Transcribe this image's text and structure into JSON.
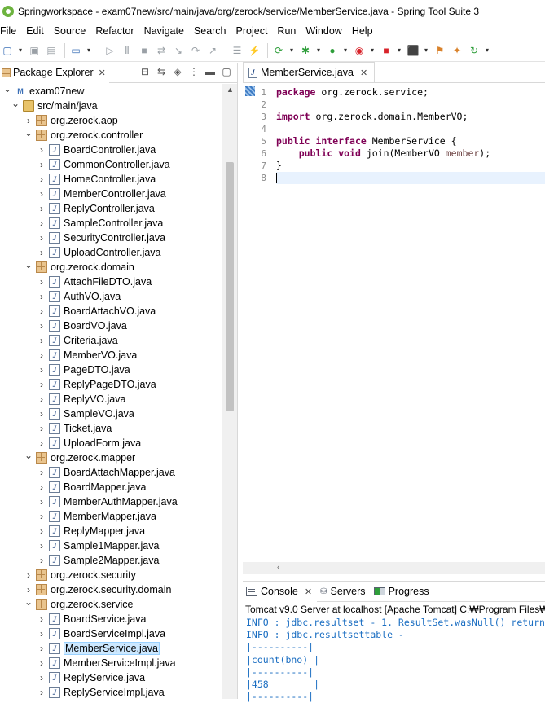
{
  "window": {
    "title": "Springworkspace - exam07new/src/main/java/org/zerock/service/MemberService.java - Spring Tool Suite 3"
  },
  "menu": [
    "File",
    "Edit",
    "Source",
    "Refactor",
    "Navigate",
    "Search",
    "Project",
    "Run",
    "Window",
    "Help"
  ],
  "package_explorer": {
    "tab_label": "Package Explorer",
    "close_glyph": "✕",
    "tree": [
      {
        "depth": 0,
        "twist": "expanded",
        "icon": "project-icon",
        "label": "exam07new"
      },
      {
        "depth": 1,
        "twist": "expanded",
        "icon": "source-folder-icon",
        "label": "src/main/java"
      },
      {
        "depth": 2,
        "twist": "collapsed",
        "icon": "package-icon",
        "label": "org.zerock.aop"
      },
      {
        "depth": 2,
        "twist": "expanded",
        "icon": "package-icon",
        "label": "org.zerock.controller"
      },
      {
        "depth": 3,
        "twist": "collapsed",
        "icon": "java-file-icon",
        "label": "BoardController.java"
      },
      {
        "depth": 3,
        "twist": "collapsed",
        "icon": "java-file-icon",
        "label": "CommonController.java"
      },
      {
        "depth": 3,
        "twist": "collapsed",
        "icon": "java-file-icon",
        "label": "HomeController.java"
      },
      {
        "depth": 3,
        "twist": "collapsed",
        "icon": "java-file-icon",
        "label": "MemberController.java"
      },
      {
        "depth": 3,
        "twist": "collapsed",
        "icon": "java-file-icon",
        "label": "ReplyController.java"
      },
      {
        "depth": 3,
        "twist": "collapsed",
        "icon": "java-file-icon",
        "label": "SampleController.java"
      },
      {
        "depth": 3,
        "twist": "collapsed",
        "icon": "java-file-icon",
        "label": "SecurityController.java"
      },
      {
        "depth": 3,
        "twist": "collapsed",
        "icon": "java-file-icon",
        "label": "UploadController.java"
      },
      {
        "depth": 2,
        "twist": "expanded",
        "icon": "package-icon",
        "label": "org.zerock.domain"
      },
      {
        "depth": 3,
        "twist": "collapsed",
        "icon": "java-file-icon",
        "label": "AttachFileDTO.java"
      },
      {
        "depth": 3,
        "twist": "collapsed",
        "icon": "java-file-icon",
        "label": "AuthVO.java"
      },
      {
        "depth": 3,
        "twist": "collapsed",
        "icon": "java-file-icon",
        "label": "BoardAttachVO.java"
      },
      {
        "depth": 3,
        "twist": "collapsed",
        "icon": "java-file-icon",
        "label": "BoardVO.java"
      },
      {
        "depth": 3,
        "twist": "collapsed",
        "icon": "java-file-icon",
        "label": "Criteria.java"
      },
      {
        "depth": 3,
        "twist": "collapsed",
        "icon": "java-file-icon",
        "label": "MemberVO.java"
      },
      {
        "depth": 3,
        "twist": "collapsed",
        "icon": "java-file-icon",
        "label": "PageDTO.java"
      },
      {
        "depth": 3,
        "twist": "collapsed",
        "icon": "java-file-icon",
        "label": "ReplyPageDTO.java"
      },
      {
        "depth": 3,
        "twist": "collapsed",
        "icon": "java-file-icon",
        "label": "ReplyVO.java"
      },
      {
        "depth": 3,
        "twist": "collapsed",
        "icon": "java-file-icon",
        "label": "SampleVO.java"
      },
      {
        "depth": 3,
        "twist": "collapsed",
        "icon": "java-file-icon",
        "label": "Ticket.java"
      },
      {
        "depth": 3,
        "twist": "collapsed",
        "icon": "java-file-icon",
        "label": "UploadForm.java"
      },
      {
        "depth": 2,
        "twist": "expanded",
        "icon": "package-icon",
        "label": "org.zerock.mapper"
      },
      {
        "depth": 3,
        "twist": "collapsed",
        "icon": "java-file-icon",
        "label": "BoardAttachMapper.java"
      },
      {
        "depth": 3,
        "twist": "collapsed",
        "icon": "java-file-icon",
        "label": "BoardMapper.java"
      },
      {
        "depth": 3,
        "twist": "collapsed",
        "icon": "java-file-icon",
        "label": "MemberAuthMapper.java"
      },
      {
        "depth": 3,
        "twist": "collapsed",
        "icon": "java-file-icon",
        "label": "MemberMapper.java"
      },
      {
        "depth": 3,
        "twist": "collapsed",
        "icon": "java-file-icon",
        "label": "ReplyMapper.java"
      },
      {
        "depth": 3,
        "twist": "collapsed",
        "icon": "java-file-icon",
        "label": "Sample1Mapper.java"
      },
      {
        "depth": 3,
        "twist": "collapsed",
        "icon": "java-file-icon",
        "label": "Sample2Mapper.java"
      },
      {
        "depth": 2,
        "twist": "collapsed",
        "icon": "package-icon",
        "label": "org.zerock.security"
      },
      {
        "depth": 2,
        "twist": "collapsed",
        "icon": "package-icon",
        "label": "org.zerock.security.domain"
      },
      {
        "depth": 2,
        "twist": "expanded",
        "icon": "package-icon",
        "label": "org.zerock.service"
      },
      {
        "depth": 3,
        "twist": "collapsed",
        "icon": "java-file-icon",
        "label": "BoardService.java"
      },
      {
        "depth": 3,
        "twist": "collapsed",
        "icon": "java-file-icon",
        "label": "BoardServiceImpl.java"
      },
      {
        "depth": 3,
        "twist": "collapsed",
        "icon": "java-file-icon",
        "label": "MemberService.java",
        "selected": true
      },
      {
        "depth": 3,
        "twist": "collapsed",
        "icon": "java-file-icon",
        "label": "MemberServiceImpl.java"
      },
      {
        "depth": 3,
        "twist": "collapsed",
        "icon": "java-file-icon",
        "label": "ReplyService.java"
      },
      {
        "depth": 3,
        "twist": "collapsed",
        "icon": "java-file-icon",
        "label": "ReplyServiceImpl.java"
      }
    ]
  },
  "editor": {
    "tab_label": "MemberService.java",
    "close_glyph": "✕",
    "line_numbers": [
      "1",
      "2",
      "3",
      "4",
      "5",
      "6",
      "7",
      "8"
    ],
    "code": {
      "l1_kw": "package",
      "l1_rest": " org.zerock.service;",
      "l3_kw": "import",
      "l3_rest": " org.zerock.domain.MemberVO;",
      "l5_kw1": "public",
      "l5_kw2": "interface",
      "l5_rest": " MemberService {",
      "l6_indent": "    ",
      "l6_kw1": "public",
      "l6_kw2": "void",
      "l6_mid": " join(MemberVO ",
      "l6_param": "member",
      "l6_end": ");",
      "l7": "}"
    }
  },
  "console": {
    "tabs": [
      {
        "label": "Console",
        "icon": "console-icon",
        "close": "✕"
      },
      {
        "label": "Servers",
        "icon": "servers-icon"
      },
      {
        "label": "Progress",
        "icon": "progress-icon"
      }
    ],
    "header": "Tomcat v9.0 Server at localhost [Apache Tomcat] C:₩Program Files₩",
    "lines": [
      "INFO : jdbc.resultset - 1. ResultSet.wasNull() return",
      "INFO : jdbc.resultsettable -",
      "|----------|",
      "|count(bno) |",
      "|----------|",
      "|458        |",
      "|----------|"
    ],
    "text_color": "#1b6ec2"
  },
  "colors": {
    "keyword": "#7f0055",
    "selection": "#cce8ff",
    "current_line": "#e8f2fe",
    "spring_green": "#6db33f"
  }
}
